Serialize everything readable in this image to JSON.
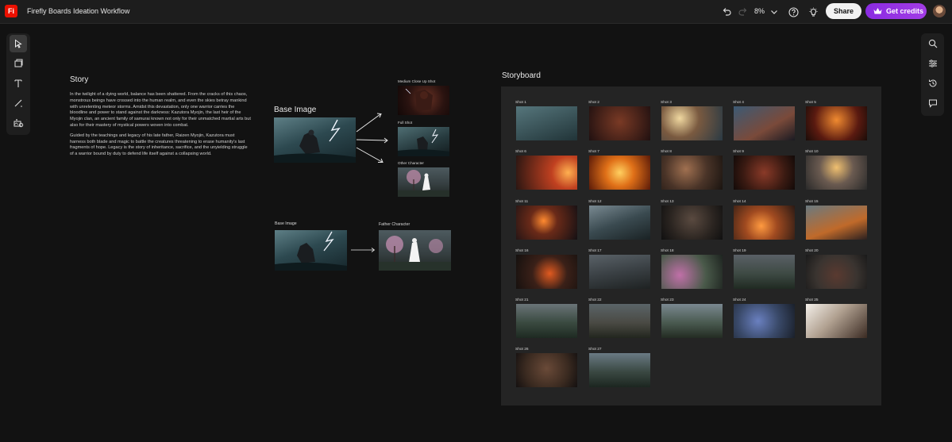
{
  "app": {
    "logo": "Fi",
    "title": "Firefly Boards Ideation Workflow",
    "zoom": "8%",
    "share_label": "Share",
    "credits_label": "Get credits",
    "accent_color": "#8a2be2"
  },
  "icons": {
    "left_toolbar": [
      "select-icon",
      "insert-image-icon",
      "text-icon",
      "line-icon",
      "generate-icon"
    ],
    "right_toolbar": [
      "search-icon",
      "adjust-icon",
      "history-icon",
      "comment-icon"
    ],
    "top_bar": [
      "undo-icon",
      "redo-icon",
      "chevron-down-icon",
      "help-icon",
      "lightbulb-icon",
      "crown-icon"
    ]
  },
  "story": {
    "title": "Story",
    "paragraph_1": "In the twilight of a dying world, balance has been shattered. From the cracks of this chaos, monstrous beings have crossed into the human realm, and even the skies betray mankind with unrelenting meteor storms. Amidst this devastation, only one warrior carries the bloodline and power to stand against the darkness: Kazutora Myojin, the last heir of the Myojin clan, an ancient family of samurai known not only for their unmatched martial arts but also for their mastery of mystical powers woven into combat.",
    "paragraph_2": "Guided by the teachings and legacy of his late father, Raizen Myojin, Kazutora must harness both blade and magic to battle the creatures threatening to erase humanity's last fragments of hope. Legacy is the story of inheritance, sacrifice, and the unyielding struggle of a warrior bound by duty to defend life itself against a collapsing world."
  },
  "base_group": {
    "title": "Base Image",
    "outputs": [
      "Medium Close Up Shot",
      "Full Shot",
      "Other Character"
    ]
  },
  "father_group": {
    "base_label": "Base Image",
    "output_label": "Father Character"
  },
  "storyboard": {
    "title": "Storyboard",
    "shots": [
      "Shot 1",
      "Shot 2",
      "Shot 3",
      "Shot 4",
      "Shot 5",
      "Shot 6",
      "Shot 7",
      "Shot 8",
      "Shot 9",
      "Shot 10",
      "Shot 11",
      "Shot 12",
      "Shot 13",
      "Shot 14",
      "Shot 15",
      "Shot 16",
      "Shot 17",
      "Shot 18",
      "Shot 19",
      "Shot 20",
      "Shot 21",
      "Shot 22",
      "Shot 23",
      "Shot 24",
      "Shot 25",
      "Shot 26",
      "Shot 27"
    ]
  }
}
